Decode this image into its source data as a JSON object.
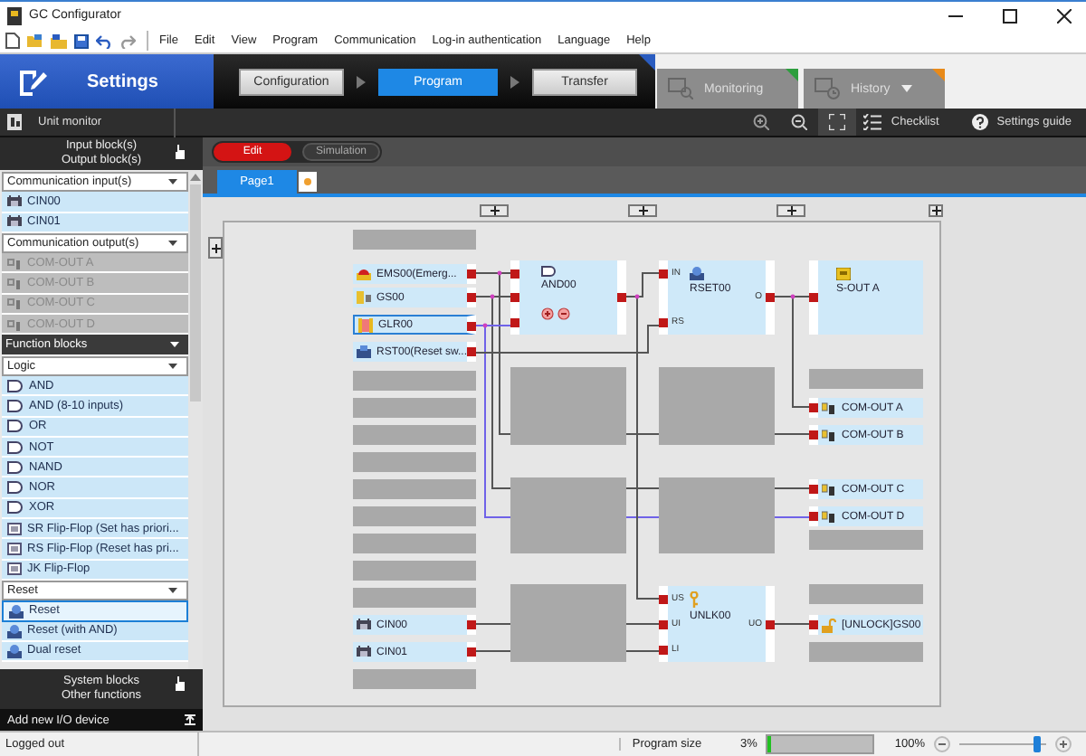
{
  "window": {
    "title": "GC Configurator"
  },
  "menu": [
    "File",
    "Edit",
    "View",
    "Program",
    "Communication",
    "Log-in authentication",
    "Language",
    "Help"
  ],
  "mode": {
    "label": "Settings"
  },
  "steps": [
    {
      "label": "Configuration",
      "selected": false
    },
    {
      "label": "Program",
      "selected": true
    },
    {
      "label": "Transfer",
      "selected": false
    }
  ],
  "monitor_tabs": [
    {
      "label": "Monitoring",
      "color": "#2e9e3e",
      "dropdown": false
    },
    {
      "label": "History",
      "color": "#e88a1a",
      "dropdown": true
    }
  ],
  "toolbar": {
    "unit_monitor": "Unit monitor",
    "checklist": "Checklist",
    "settings_guide": "Settings guide"
  },
  "palette": {
    "overlay_top": [
      "Input block(s)",
      "Output block(s)"
    ],
    "rows": [
      {
        "kind": "dropdown",
        "label": "Communication input(s)"
      },
      {
        "kind": "comm_input",
        "label": "CIN00",
        "disabled": false,
        "selected": false
      },
      {
        "kind": "comm_input",
        "label": "CIN01",
        "disabled": false,
        "selected": false
      },
      {
        "kind": "dropdown",
        "label": "Communication output(s)"
      },
      {
        "kind": "comm_output",
        "label": "COM-OUT A",
        "disabled": true,
        "selected": false
      },
      {
        "kind": "comm_output",
        "label": "COM-OUT B",
        "disabled": true,
        "selected": false
      },
      {
        "kind": "comm_output",
        "label": "COM-OUT C",
        "disabled": true,
        "selected": false
      },
      {
        "kind": "comm_output",
        "label": "COM-OUT D",
        "disabled": true,
        "selected": false
      },
      {
        "kind": "header",
        "label": "Function blocks"
      },
      {
        "kind": "dropdown",
        "label": "Logic"
      },
      {
        "kind": "logic_gate",
        "label": "AND",
        "disabled": false,
        "selected": false
      },
      {
        "kind": "logic_gate",
        "label": "AND (8-10 inputs)",
        "disabled": false,
        "selected": false
      },
      {
        "kind": "logic_gate",
        "label": "OR",
        "disabled": false,
        "selected": false
      },
      {
        "kind": "logic_gate",
        "label": "NOT",
        "disabled": false,
        "selected": false
      },
      {
        "kind": "logic_gate",
        "label": "NAND",
        "disabled": false,
        "selected": false
      },
      {
        "kind": "logic_gate",
        "label": "NOR",
        "disabled": false,
        "selected": false
      },
      {
        "kind": "logic_gate",
        "label": "XOR",
        "disabled": false,
        "selected": false
      },
      {
        "kind": "flip_flop",
        "label": "SR Flip-Flop (Set has priori...",
        "disabled": false,
        "selected": false
      },
      {
        "kind": "flip_flop",
        "label": "RS Flip-Flop (Reset has pri...",
        "disabled": false,
        "selected": false
      },
      {
        "kind": "flip_flop",
        "label": "JK Flip-Flop",
        "disabled": false,
        "selected": false
      },
      {
        "kind": "dropdown",
        "label": "Reset"
      },
      {
        "kind": "reset_block",
        "label": "Reset",
        "disabled": false,
        "selected": true
      },
      {
        "kind": "reset_block",
        "label": "Reset (with AND)",
        "disabled": false,
        "selected": false
      },
      {
        "kind": "reset_block",
        "label": "Dual reset",
        "disabled": false,
        "selected": false
      }
    ],
    "overlay_bottom": [
      "System blocks",
      "Other functions"
    ],
    "add_device": "Add new I/O device"
  },
  "edit_mode": [
    {
      "label": "Edit",
      "selected": true
    },
    {
      "label": "Simulation",
      "selected": false
    }
  ],
  "pages": [
    {
      "label": "Page1",
      "selected": true
    }
  ],
  "diagram": {
    "inputs": [
      {
        "label": "EMS00(Emerg...",
        "kind": "emergency",
        "selected": false
      },
      {
        "label": "GS00",
        "kind": "gate_switch",
        "selected": false
      },
      {
        "label": "GLR00",
        "kind": "light_curtain",
        "selected": true
      },
      {
        "label": "RST00(Reset sw...",
        "kind": "reset",
        "selected": false
      },
      {
        "label": "CIN00",
        "kind": "comm",
        "selected": false
      },
      {
        "label": "CIN01",
        "kind": "comm",
        "selected": false
      }
    ],
    "functions": [
      {
        "label": "AND00",
        "kind": "and"
      },
      {
        "label": "RSET00",
        "kind": "reset",
        "ports_in": [
          "IN",
          "RS"
        ],
        "port_out": "O"
      },
      {
        "label": "UNLK00",
        "kind": "unlock",
        "ports_in": [
          "US",
          "UI",
          "LI"
        ],
        "port_out": "UO"
      }
    ],
    "outputs": [
      {
        "label": "S-OUT A",
        "kind": "safety_out"
      },
      {
        "label": "COM-OUT A",
        "kind": "comm"
      },
      {
        "label": "COM-OUT B",
        "kind": "comm"
      },
      {
        "label": "COM-OUT C",
        "kind": "comm"
      },
      {
        "label": "COM-OUT D",
        "kind": "comm"
      },
      {
        "label": "[UNLOCK]GS00",
        "kind": "unlock"
      }
    ]
  },
  "status_bar": {
    "user": "Logged out",
    "program_size_label": "Program size",
    "program_size": "3%",
    "program_bar": {
      "level": 0.03
    },
    "zoom": "100%",
    "zoom_slider": {
      "level": 0.9
    }
  }
}
